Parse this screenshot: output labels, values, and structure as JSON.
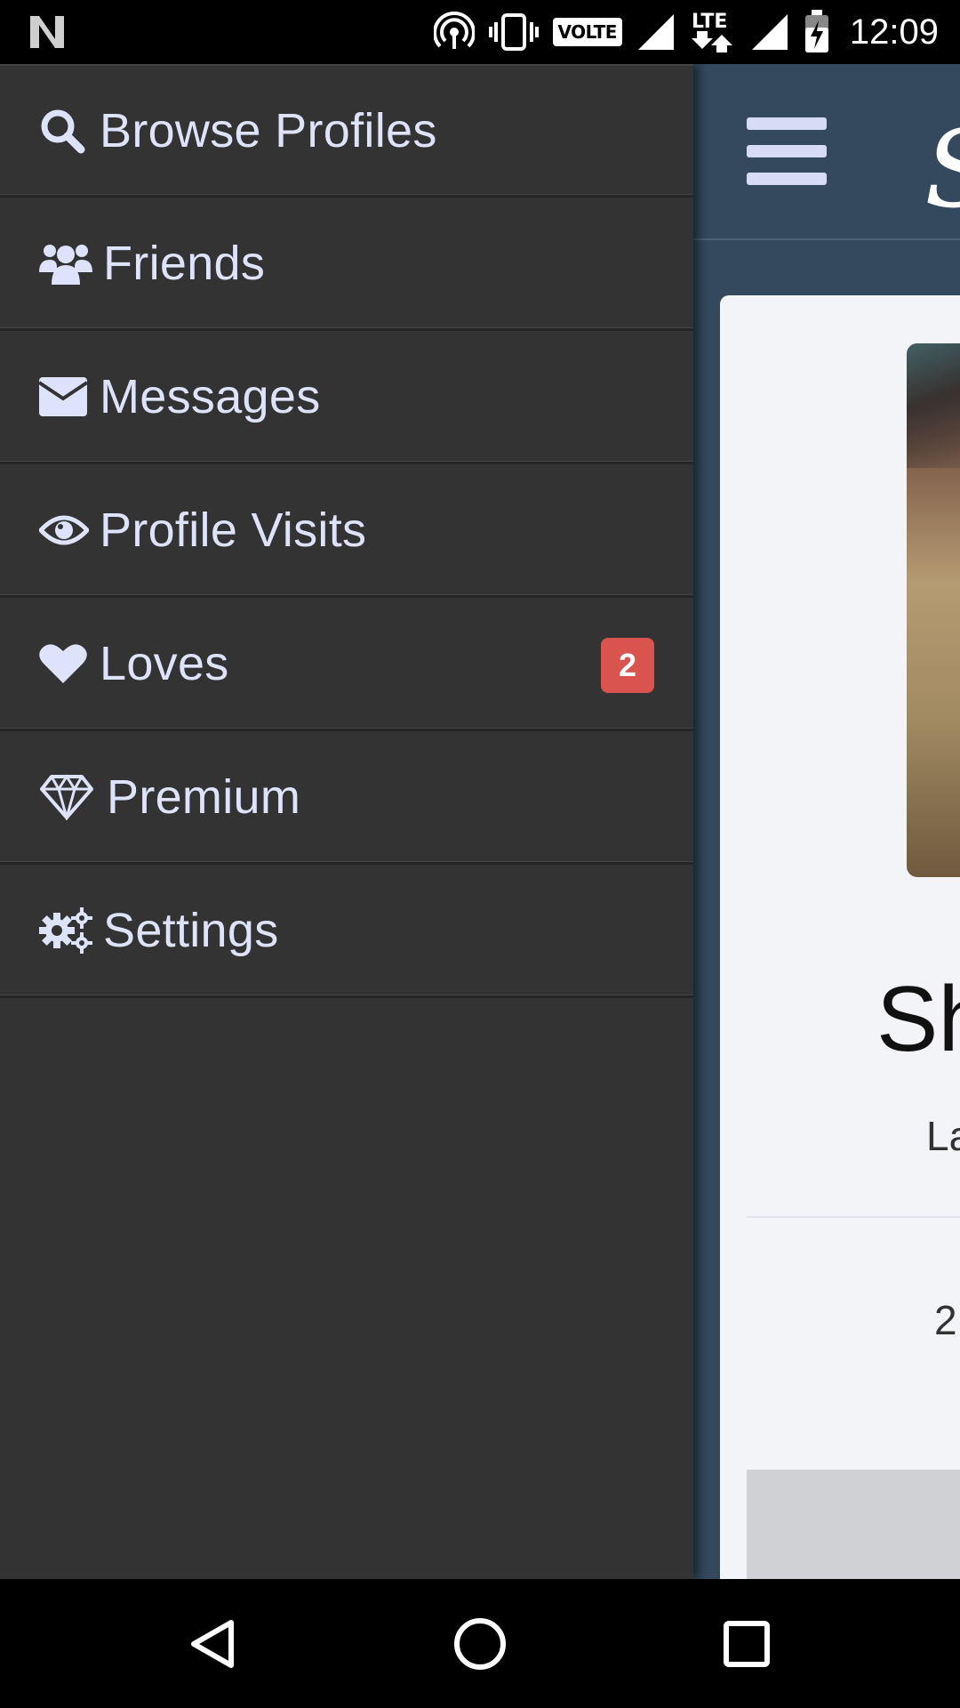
{
  "status_bar": {
    "time": "12:09",
    "volte_label": "VOLTE",
    "network_label": "LTE",
    "icons": [
      "n-logo-icon",
      "hotspot-icon",
      "vibrate-icon",
      "volte-icon",
      "signal-icon",
      "lte-icon",
      "signal-icon",
      "battery-charging-icon"
    ]
  },
  "drawer": {
    "items": [
      {
        "label": "Browse Profiles",
        "icon": "search-icon"
      },
      {
        "label": "Friends",
        "icon": "users-icon"
      },
      {
        "label": "Messages",
        "icon": "envelope-icon"
      },
      {
        "label": "Profile Visits",
        "icon": "eye-icon"
      },
      {
        "label": "Loves",
        "icon": "heart-icon",
        "badge": "2"
      },
      {
        "label": "Premium",
        "icon": "diamond-icon"
      },
      {
        "label": "Settings",
        "icon": "gears-icon"
      }
    ]
  },
  "app": {
    "brand_partial": "S",
    "profile_name_partial": "Sh",
    "profile_sub_partial": "La",
    "profile_stat_partial": "2"
  },
  "colors": {
    "drawer_bg": "#333333",
    "menu_text": "#dde3fb",
    "badge_bg": "#d9534f",
    "app_bg": "#34495e"
  },
  "nav_bar": {
    "buttons": [
      "back-icon",
      "home-icon",
      "recents-icon"
    ]
  }
}
